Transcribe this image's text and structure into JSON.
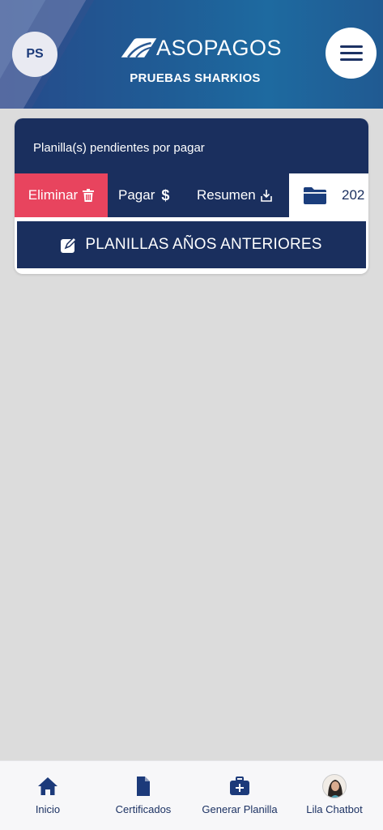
{
  "header": {
    "avatar_initials": "PS",
    "brand": "ASOPAGOS",
    "subtitle": "PRUEBAS SHARKIOS",
    "menu_icon": "hamburger-menu-icon"
  },
  "card": {
    "title": "Planilla(s) pendientes por pagar",
    "actions": {
      "eliminar": "Eliminar",
      "pagar": "Pagar",
      "resumen": "Resumen",
      "year": "202"
    },
    "anteriores_label": "PLANILLAS AÑOS ANTERIORES"
  },
  "bottom_nav": [
    {
      "label": "Inicio",
      "icon": "home-icon"
    },
    {
      "label": "Certificados",
      "icon": "document-icon"
    },
    {
      "label": "Generar Planilla",
      "icon": "briefcase-plus-icon"
    },
    {
      "label": "Lila Chatbot",
      "icon": "chatbot-avatar"
    }
  ],
  "colors": {
    "primary": "#1a2f5e",
    "danger": "#e8445e",
    "background": "#dcdcdc"
  }
}
